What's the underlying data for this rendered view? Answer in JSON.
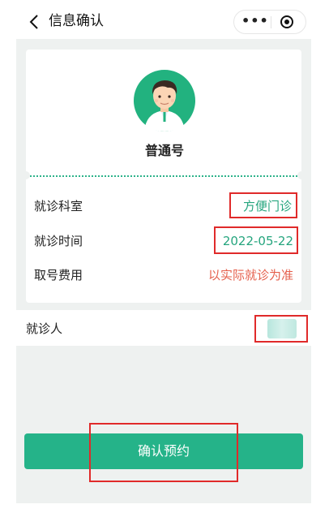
{
  "nav": {
    "title": "信息确认",
    "more_label": "•••",
    "back_icon": "chevron-left-icon",
    "close_icon": "target-icon"
  },
  "ticket": {
    "type": "普通号",
    "avatar_icon": "doctor-avatar-icon"
  },
  "details": [
    {
      "label": "就诊科室",
      "value": "方便门诊"
    },
    {
      "label": "就诊时间",
      "value": "2022-05-22"
    },
    {
      "label": "取号费用",
      "value": "以实际就诊为准"
    }
  ],
  "patient": {
    "label": "就诊人"
  },
  "confirm": {
    "label": "确认预约"
  },
  "colors": {
    "accent": "#25b389",
    "value_green": "#25a57e",
    "value_red": "#e5604d",
    "highlight_box": "#e02a2a",
    "page_bg": "#eef1f0"
  }
}
